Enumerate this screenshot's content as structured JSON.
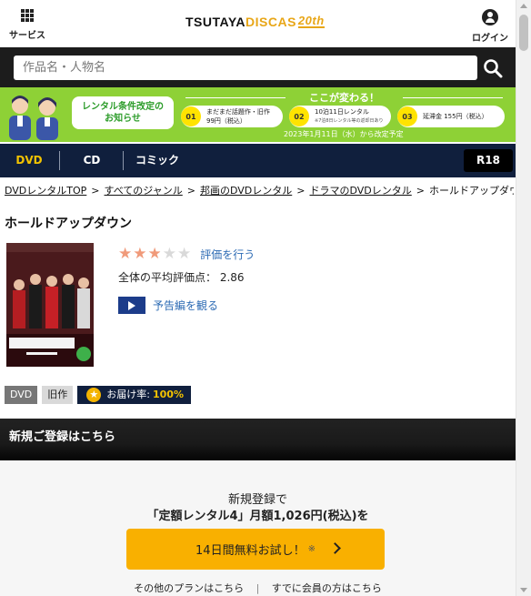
{
  "header": {
    "services_label": "サービス",
    "login_label": "ログイン",
    "logo": {
      "part1": "TSUTAYA",
      "part2": "DISCAS",
      "part3": "20th"
    }
  },
  "search": {
    "placeholder": "作品名・人物名"
  },
  "banner": {
    "announce_line1": "レンタル条件改定の",
    "announce_line2": "お知らせ",
    "changes_title": "ここが変わる！",
    "items": [
      {
        "num": "01",
        "text": "まだまだ話題作・旧作",
        "sub": "99円（税込）"
      },
      {
        "num": "02",
        "text": "10泊11日レンタル",
        "sub": "※7泊8日レンタル等の返却日あり"
      },
      {
        "num": "03",
        "text": "延滞金 155円（税込）",
        "sub": ""
      }
    ],
    "date_note": "2023年1月11日（水）から改定予定"
  },
  "nav": {
    "items": [
      "DVD",
      "CD",
      "コミック"
    ],
    "r18": "R18"
  },
  "breadcrumb": {
    "items": [
      "DVDレンタルTOP",
      "すべてのジャンル",
      "邦画のDVDレンタル",
      "ドラマのDVDレンタル",
      "ホールドアップダウン"
    ],
    "separator": ">"
  },
  "title": "ホールドアップダウン",
  "rating": {
    "value": 2.86,
    "max": 5,
    "rate_label": "評価を行う",
    "avg_label": "全体の平均評価点：",
    "avg_value": "2.86"
  },
  "trailer_label": "予告編を観る",
  "tags": {
    "format": "DVD",
    "category": "旧作",
    "delivery_label": "お届け率:",
    "delivery_value": "100%"
  },
  "registration": {
    "header": "新規ご登録はこちら",
    "line1": "新規登録で",
    "line2": "「定額レンタル4」月額1,026円(税込)を",
    "button": "14日間無料お試し！",
    "button_note": "※",
    "other_plans": "その他のプランはこちら",
    "members": "すでに会員の方はこちら"
  },
  "colors": {
    "navy": "#101f3d",
    "green_banner": "#8ed136",
    "accent_yellow": "#f9b000",
    "link_blue": "#2d6bb4",
    "star_on": "#f09a7a",
    "star_off": "#d9d9d9"
  }
}
